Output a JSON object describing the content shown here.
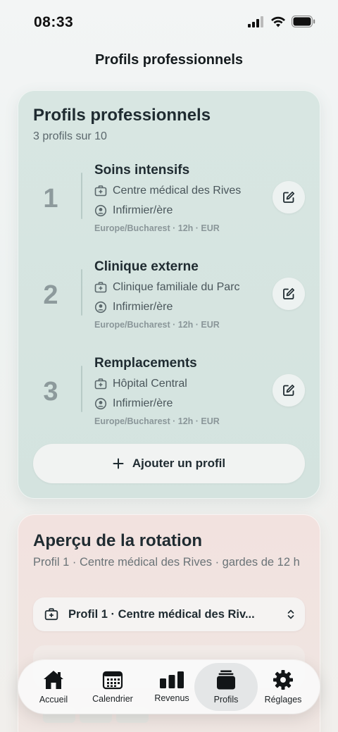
{
  "status": {
    "time": "08:33"
  },
  "nav": {
    "title": "Profils professionnels"
  },
  "profiles_card": {
    "title": "Profils professionnels",
    "subtitle": "3 profils sur 10",
    "add_label": "Ajouter un profil",
    "items": [
      {
        "number": "1",
        "name": "Soins intensifs",
        "facility": "Centre médical des Rives",
        "role": "Infirmier/ère",
        "meta": "Europe/Bucharest · 12h · EUR"
      },
      {
        "number": "2",
        "name": "Clinique externe",
        "facility": "Clinique familiale du Parc",
        "role": "Infirmier/ère",
        "meta": "Europe/Bucharest · 12h · EUR"
      },
      {
        "number": "3",
        "name": "Remplacements",
        "facility": "Hôpital Central",
        "role": "Infirmier/ère",
        "meta": "Europe/Bucharest · 12h · EUR"
      }
    ]
  },
  "rotation_card": {
    "title": "Aperçu de la rotation",
    "subtitle": "Profil 1 · Centre médical des Rives · gardes de 12 h",
    "selected_profile": "Profil 1 · Centre médical des Riv..."
  },
  "tabbar": {
    "items": [
      {
        "label": "Accueil",
        "icon": "house-icon"
      },
      {
        "label": "Calendrier",
        "icon": "calendar-icon"
      },
      {
        "label": "Revenus",
        "icon": "bar-chart-icon"
      },
      {
        "label": "Profils",
        "icon": "stack-icon",
        "active": true
      },
      {
        "label": "Réglages",
        "icon": "gear-icon"
      }
    ]
  },
  "colors": {
    "profiles_card_bg": "#d6e4e0",
    "rotation_card_bg": "#f0e3df",
    "active_tab_bg": "#e4e6e7"
  }
}
